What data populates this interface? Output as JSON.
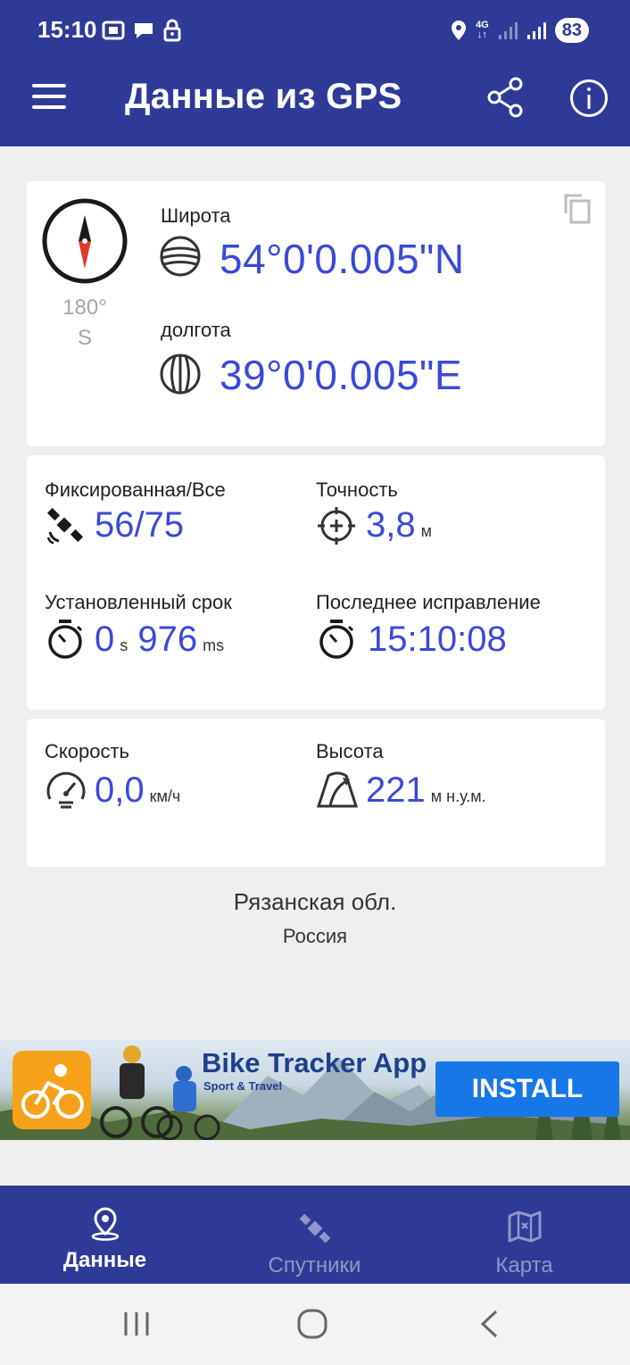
{
  "status_bar": {
    "time": "15:10",
    "network": "4G",
    "battery": "83",
    "icons": [
      "screenshot-icon",
      "chat-icon",
      "lock-icon",
      "location-icon",
      "signal-icon",
      "signal-icon",
      "battery-icon"
    ]
  },
  "app_bar": {
    "title": "Данные из GPS",
    "icons": [
      "menu-icon",
      "share-icon",
      "info-icon"
    ]
  },
  "coords_card": {
    "heading_degrees": "180°",
    "heading_direction": "S",
    "latitude_label": "Широта",
    "latitude_value": "54°0'0.005\"N",
    "longitude_label": "долгота",
    "longitude_value": "39°0'0.005\"E",
    "icons": [
      "compass-icon",
      "copy-icon",
      "latitude-globe-icon",
      "longitude-globe-icon"
    ]
  },
  "fix_card": {
    "satellites_label": "Фиксированная/Все",
    "satellites_value": "56/75",
    "accuracy_label": "Точность",
    "accuracy_value": "3,8",
    "accuracy_unit": "м",
    "ttff_label": "Установленный срок",
    "ttff_seconds": "0",
    "ttff_seconds_unit": "s",
    "ttff_ms": "976",
    "ttff_ms_unit": "ms",
    "last_fix_label": "Последнее исправление",
    "last_fix_value": "15:10:08"
  },
  "motion_card": {
    "speed_label": "Скорость",
    "speed_value": "0,0",
    "speed_unit": "км/ч",
    "altitude_label": "Высота",
    "altitude_value": "221",
    "altitude_unit": "м н.у.м."
  },
  "location": {
    "region": "Рязанская обл.",
    "country": "Россия"
  },
  "ad": {
    "title": "Bike Tracker App",
    "subtitle": "Sport & Travel",
    "install_label": "INSTALL"
  },
  "bottom_nav": {
    "items": [
      {
        "label": "Данные",
        "icon": "location-pin-icon",
        "active": true
      },
      {
        "label": "Спутники",
        "icon": "satellite-icon",
        "active": false
      },
      {
        "label": "Карта",
        "icon": "map-icon",
        "active": false
      }
    ]
  },
  "colors": {
    "primary": "#2f3a96",
    "value_blue": "#3a4ad8",
    "install_blue": "#1877e6",
    "ad_orange": "#f5a21a",
    "compass_red": "#e03a2a"
  }
}
